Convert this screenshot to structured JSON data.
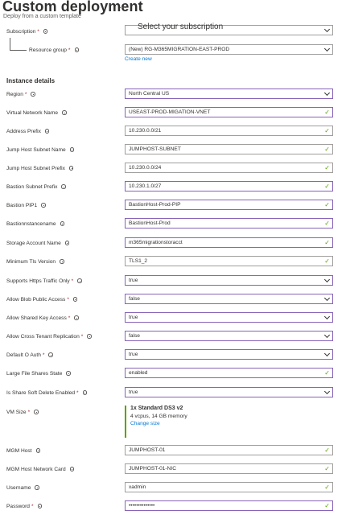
{
  "header": {
    "title": "Custom deployment",
    "more": "...",
    "subtitle": "Deploy from a custom template"
  },
  "subscription": {
    "label": "Subscription",
    "value": "Select your subscription"
  },
  "resource_group": {
    "label": "Resource group",
    "value": "(New) RG-M365MIGRATION-EAST-PROD",
    "create_new": "Create new"
  },
  "instance_details": "Instance details",
  "fields": [
    {
      "label": "Region",
      "required": true,
      "value": "North Central US",
      "kind": "select"
    },
    {
      "label": "Virtual Network Name",
      "required": false,
      "value": "USEAST-PROD-MIGATION-VNET",
      "kind": "text"
    },
    {
      "label": "Address Prefix",
      "required": false,
      "value": "10.230.0.0/21",
      "kind": "text"
    },
    {
      "label": "Jump Host Subnet Name",
      "required": false,
      "value": "JUMPHOST-SUBNET",
      "kind": "text"
    },
    {
      "label": "Jump Host Subnet Prefix",
      "required": false,
      "value": "10.230.0.0/24",
      "kind": "text"
    },
    {
      "label": "Bastion Subnet Prefix",
      "required": false,
      "value": "10.230.1.0/27",
      "kind": "text"
    },
    {
      "label": "Bastion PIP1",
      "required": false,
      "value": "BastionHost-Prod-PIP",
      "kind": "text"
    },
    {
      "label": "Bastionnstancename",
      "required": false,
      "value": "BastionHost-Prod",
      "kind": "text"
    },
    {
      "label": "Storage Account Name",
      "required": false,
      "value": "m365migrationstoracct",
      "kind": "text"
    },
    {
      "label": "Minimum Tls Version",
      "required": false,
      "value": "TLS1_2",
      "kind": "text"
    },
    {
      "label": "Supports Https Traffic Only",
      "required": true,
      "value": "true",
      "kind": "select"
    },
    {
      "label": "Allow Blob Public Access",
      "required": true,
      "value": "false",
      "kind": "select"
    },
    {
      "label": "Allow Shared Key Access",
      "required": true,
      "value": "true",
      "kind": "select"
    },
    {
      "label": "Allow Cross Tenant Replication",
      "required": true,
      "value": "false",
      "kind": "select"
    },
    {
      "label": "Default O Auth",
      "required": true,
      "value": "true",
      "kind": "select"
    },
    {
      "label": "Large File Shares State",
      "required": false,
      "value": "enabled",
      "kind": "text"
    },
    {
      "label": "Is Share Soft Delete Enabled",
      "required": true,
      "value": "true",
      "kind": "select"
    }
  ],
  "vm_size": {
    "label": "VM Size",
    "name": "1x Standard DS3 v2",
    "spec": "4 vcpus, 14 GB memory",
    "change": "Change size"
  },
  "bottom_fields": [
    {
      "label": "MGM Host",
      "required": false,
      "value": "JUMPHOST-01"
    },
    {
      "label": "MGM Host Network Card",
      "required": false,
      "value": "JUMPHOST-01-NIC"
    },
    {
      "label": "Username",
      "required": false,
      "value": "xadmin"
    },
    {
      "label": "Password",
      "required": true,
      "value": "••••••••••••••"
    }
  ],
  "colors": {
    "accent": "#8764b8",
    "valid": "#57a300",
    "link": "#0078d4",
    "required": "#a4262c"
  }
}
